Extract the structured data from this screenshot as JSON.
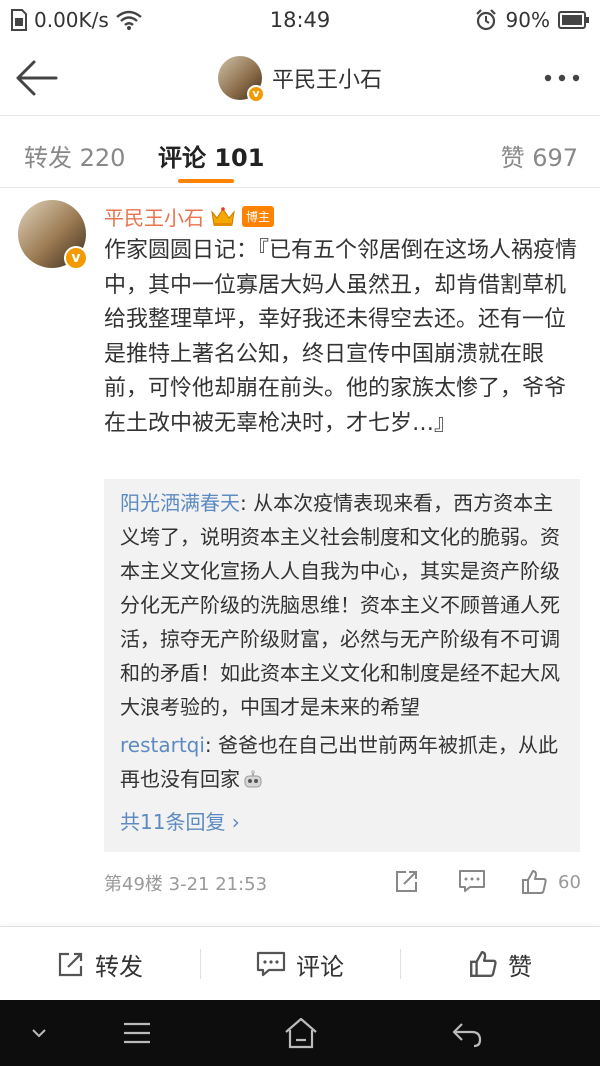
{
  "status_bar": {
    "network_speed": "0.00K/s",
    "time": "18:49",
    "battery": "90%"
  },
  "header": {
    "title": "平民王小石",
    "badge": "v"
  },
  "tabs": {
    "repost": "转发 220",
    "comment": "评论 101",
    "like": "赞 697"
  },
  "comment": {
    "author": "平民王小石",
    "badge": "博主",
    "text": "作家圆圆日记：『已有五个邻居倒在这场人祸疫情中，其中一位寡居大妈人虽然丑，却肯借割草机给我整理草坪，幸好我还未得空去还。还有一位是推特上著名公知，终日宣传中国崩溃就在眼前，可怜他却崩在前头。他的家族太惨了，爷爷在土改中被无辜枪决时，才七岁…』",
    "replies": [
      {
        "name": "阳光洒满春天",
        "text": ": 从本次疫情表现来看，西方资本主义垮了，说明资本主义社会制度和文化的脆弱。资本主义文化宣扬人人自我为中心，其实是资产阶级分化无产阶级的洗脑思维！资本主义不顾普通人死活，掠夺无产阶级财富，必然与无产阶级有不可调和的矛盾！如此资本主义文化和制度是经不起大风大浪考验的，中国才是未来的希望"
      },
      {
        "name": "restartqi",
        "text": ": 爸爸也在自己出世前两年被抓走，从此再也没有回家"
      }
    ],
    "more_replies": "共11条回复 ›",
    "floor": "第49楼",
    "time": "3-21 21:53",
    "likes": "60"
  },
  "action_bar": {
    "repost": "转发",
    "comment": "评论",
    "like": "赞"
  },
  "colors": {
    "accent": "#ff8200",
    "author_name": "#eb7350",
    "link": "#5d8ac1"
  }
}
